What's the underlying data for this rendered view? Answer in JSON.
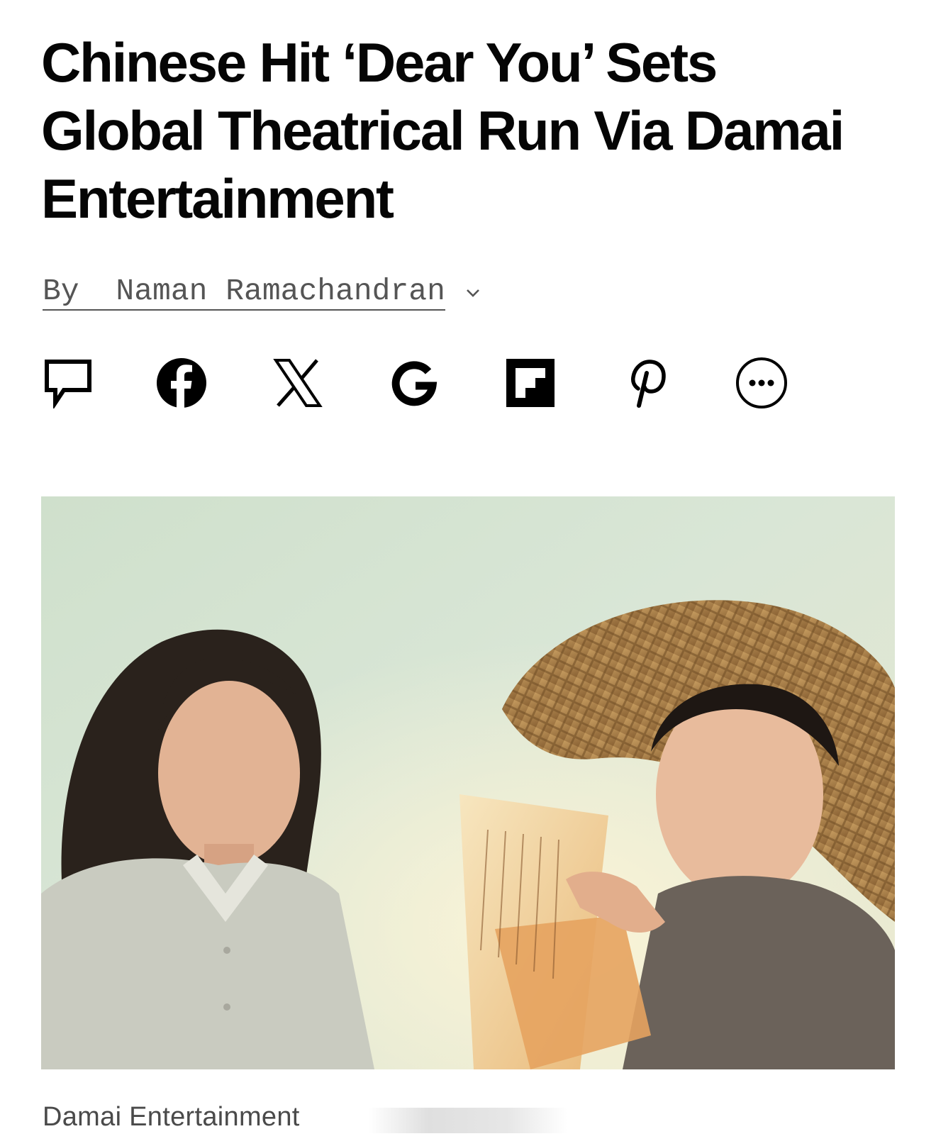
{
  "article": {
    "headline": "Chinese Hit ‘Dear You’ Sets Global Theatrical Run Via Damai Entertainment",
    "byline_prefix": "By",
    "author": "Naman Ramachandran"
  },
  "share": [
    {
      "id": "comment",
      "icon": "speech-bubble-icon"
    },
    {
      "id": "facebook",
      "icon": "facebook-icon"
    },
    {
      "id": "x",
      "icon": "x-icon"
    },
    {
      "id": "google",
      "icon": "google-icon"
    },
    {
      "id": "flipboard",
      "icon": "flipboard-icon"
    },
    {
      "id": "pinterest",
      "icon": "pinterest-icon"
    },
    {
      "id": "more",
      "icon": "more-icon"
    }
  ],
  "hero": {
    "caption": "Damai Entertainment"
  },
  "colors": {
    "text": "#050505",
    "byline": "#555555",
    "caption": "#4a4a4a"
  }
}
